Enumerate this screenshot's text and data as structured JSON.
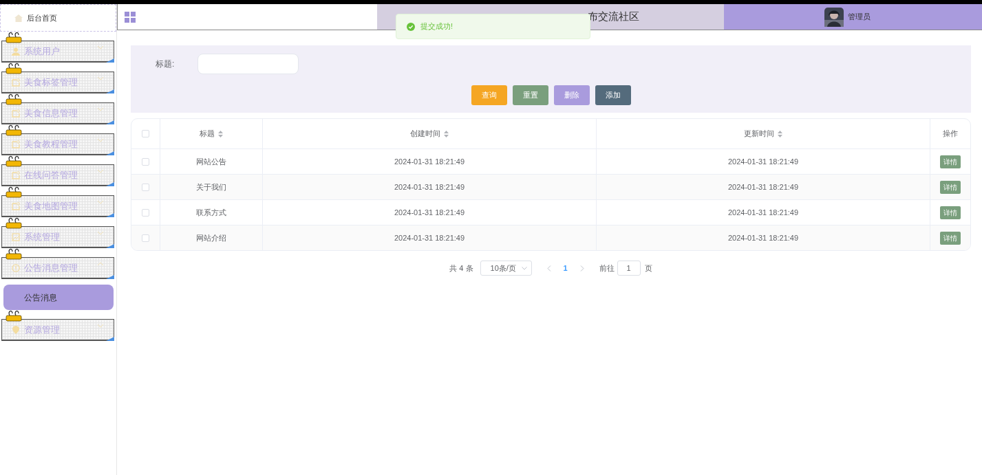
{
  "sidebar": {
    "home": {
      "label": "后台首页"
    },
    "items": [
      {
        "label": "系统用户",
        "expanded": false
      },
      {
        "label": "美食标签管理",
        "expanded": false
      },
      {
        "label": "美食信息管理",
        "expanded": false
      },
      {
        "label": "美食教程管理",
        "expanded": false
      },
      {
        "label": "在线问答管理",
        "expanded": false
      },
      {
        "label": "美食地图管理",
        "expanded": false
      },
      {
        "label": "系统管理",
        "expanded": false
      },
      {
        "label": "公告消息管理",
        "expanded": true,
        "children": [
          {
            "label": "公告消息",
            "selected": true
          }
        ]
      },
      {
        "label": "资源管理",
        "expanded": false
      }
    ]
  },
  "header": {
    "title": "布交流社区",
    "user": "管理员"
  },
  "toast": {
    "message": "提交成功!"
  },
  "search": {
    "label": "标题:",
    "buttons": [
      {
        "label": "查询",
        "kind": "query"
      },
      {
        "label": "重置",
        "kind": "reset"
      },
      {
        "label": "删除",
        "kind": "delete"
      },
      {
        "label": "添加",
        "kind": "add"
      }
    ]
  },
  "table": {
    "select_all_checked": false,
    "columns": [
      {
        "label": "标题",
        "sortable": true
      },
      {
        "label": "创建时间",
        "sortable": true
      },
      {
        "label": "更新时间",
        "sortable": true
      },
      {
        "label": "操作",
        "sortable": false
      }
    ],
    "rows": [
      {
        "checked": false,
        "cells": [
          "网站公告",
          "2024-01-31 18:21:49",
          "2024-01-31 18:21:49"
        ],
        "action": "详情"
      },
      {
        "checked": false,
        "cells": [
          "关于我们",
          "2024-01-31 18:21:49",
          "2024-01-31 18:21:49"
        ],
        "action": "详情"
      },
      {
        "checked": false,
        "cells": [
          "联系方式",
          "2024-01-31 18:21:49",
          "2024-01-31 18:21:49"
        ],
        "action": "详情"
      },
      {
        "checked": false,
        "cells": [
          "网站介绍",
          "2024-01-31 18:21:49",
          "2024-01-31 18:21:49"
        ],
        "action": "详情"
      }
    ]
  },
  "pagination": {
    "total": "共 4 条",
    "page_size": "10条/页",
    "pages": [
      {
        "label": "1",
        "selected": true
      }
    ],
    "goto_label": "前往",
    "goto_value": "1",
    "goto_suffix": "页"
  }
}
